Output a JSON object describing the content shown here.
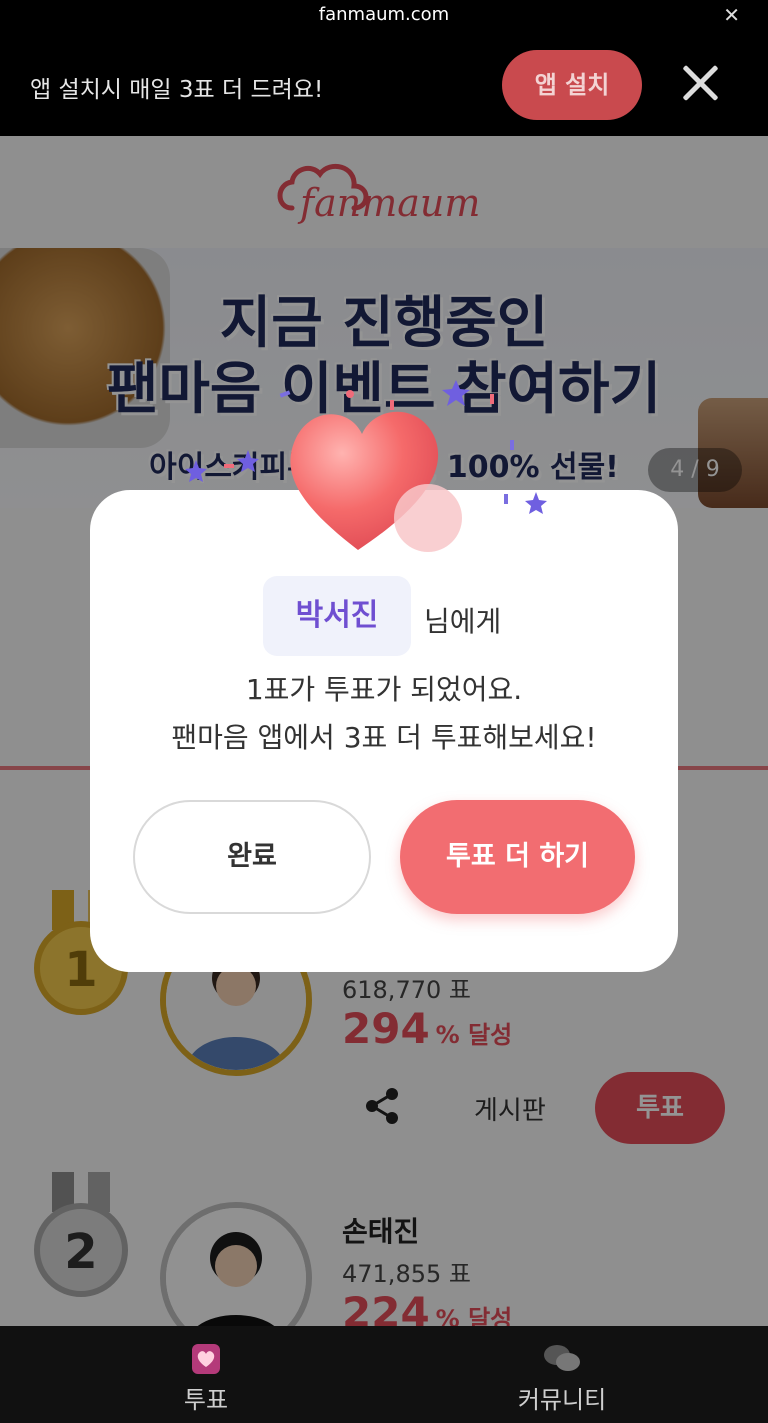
{
  "top_bar": {
    "domain": "fanmaum.com",
    "close_glyph": "✕"
  },
  "install_banner": {
    "text": "앱 설치시 매일 3표 더 드려요!",
    "install_button": "앱 설치"
  },
  "hero": {
    "logo_text": "fanmaum",
    "line1": "지금 진행중인",
    "line2": "팬마음 이벤트 참여하기",
    "line3": "아이스커피부터 ... 지, 100% 선물!",
    "slide_counter": "4 / 9"
  },
  "ranking": [
    {
      "rank": "1",
      "votes": "618,770 표",
      "percent": "294",
      "percent_unit": "% 달성",
      "share_icon": "share-icon",
      "board": "게시판",
      "vote_button": "투표"
    },
    {
      "rank": "2",
      "name": "손태진",
      "votes": "471,855 표",
      "percent": "224",
      "percent_unit": "% 달성"
    }
  ],
  "modal": {
    "recipient": "박서진",
    "recipient_suffix": "님에게",
    "message_line1": "1표가 투표가 되었어요.",
    "message_line2": "팬마음 앱에서 3표 더 투표해보세요!",
    "done_button": "완료",
    "more_button": "투표 더 하기"
  },
  "bottom_nav": [
    {
      "label": "투표",
      "icon": "heart-vote-icon"
    },
    {
      "label": "커뮤니티",
      "icon": "chat-bubbles-icon"
    }
  ],
  "colors": {
    "accent": "#f26d71",
    "vote_red": "#e24d58",
    "gold": "#d8a728",
    "purple": "#6f4fd1"
  }
}
